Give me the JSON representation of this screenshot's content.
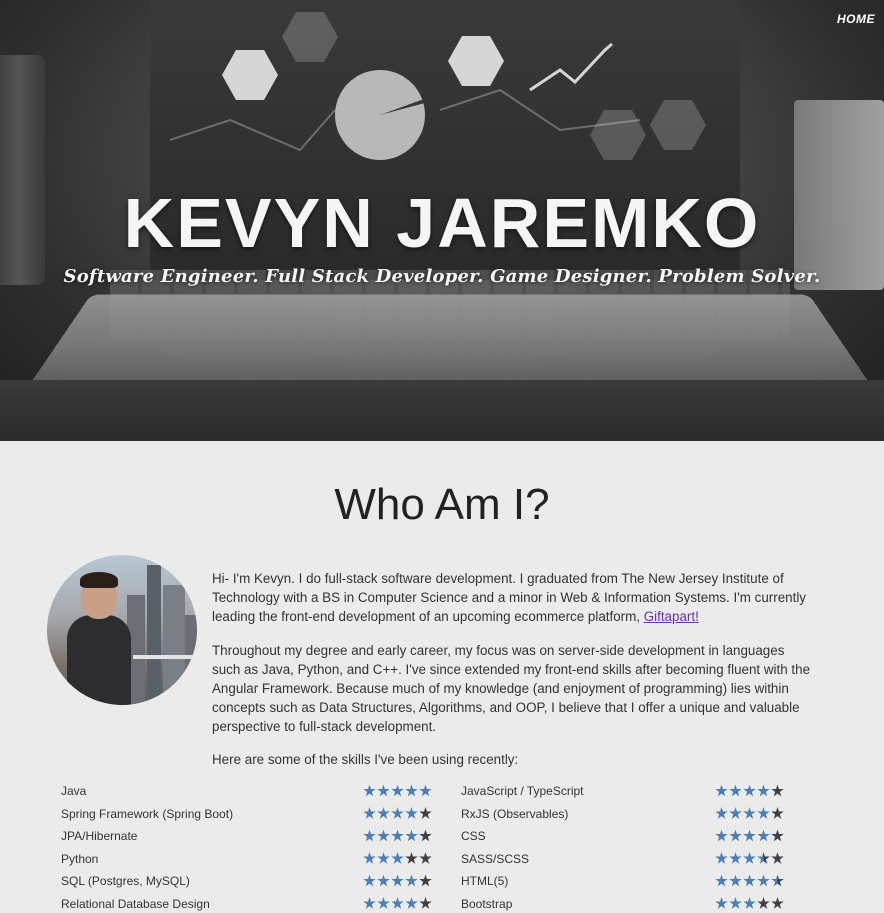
{
  "nav": {
    "home_label": "HOME"
  },
  "hero": {
    "title": "KEVYN JAREMKO",
    "subtitle": "Software Engineer.  Full Stack Developer.  Game Designer.  Problem Solver."
  },
  "about": {
    "heading": "Who Am I?",
    "para1_text": "Hi- I'm Kevyn. I do full-stack software development. I graduated from The New Jersey Institute of Technology with a BS in Computer Science and a minor in Web & Information Systems. I'm currently leading the front-end development of an upcoming ecommerce platform, ",
    "para1_link": "Giftapart!",
    "para2": "Throughout my degree and early career, my focus was on server-side development in languages such as Java, Python, and C++. I've since extended my front-end skills after becoming fluent with the Angular Framework. Because much of my knowledge (and enjoyment of programming) lies within concepts such as Data Structures, Algorithms, and OOP, I believe that I offer a unique and valuable perspective to full-stack development.",
    "skills_intro": "Here are some of the skills I've been using recently:"
  },
  "skills": {
    "left": [
      {
        "name": "Java",
        "rating": 5
      },
      {
        "name": "Spring Framework (Spring Boot)",
        "rating": 4
      },
      {
        "name": "JPA/Hibernate",
        "rating": 4
      },
      {
        "name": "Python",
        "rating": 3
      },
      {
        "name": "SQL (Postgres, MySQL)",
        "rating": 4
      },
      {
        "name": "Relational Database Design",
        "rating": 4
      }
    ],
    "right": [
      {
        "name": "JavaScript / TypeScript",
        "rating": 4
      },
      {
        "name": "RxJS (Observables)",
        "rating": 4
      },
      {
        "name": "CSS",
        "rating": 4
      },
      {
        "name": "SASS/SCSS",
        "rating": 3.5
      },
      {
        "name": "HTML(5)",
        "rating": 4.5
      },
      {
        "name": "Bootstrap",
        "rating": 3
      }
    ],
    "max_rating": 5
  },
  "colors": {
    "star_filled": "#4a7fb5",
    "star_empty": "#3f3f46",
    "link": "#6a2eb0"
  }
}
